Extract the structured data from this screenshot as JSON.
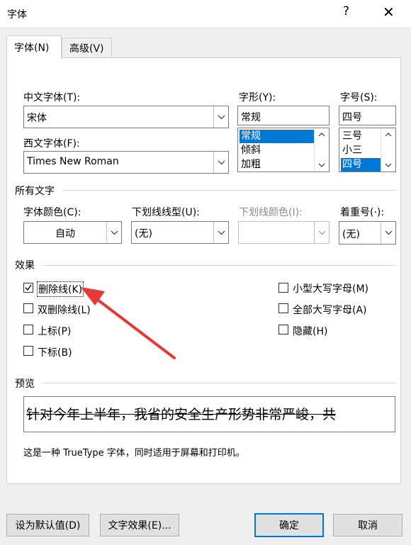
{
  "window": {
    "title": "字体",
    "help": "?",
    "close": "✕"
  },
  "tabs": [
    {
      "label": "字体(N)"
    },
    {
      "label": "高级(V)"
    }
  ],
  "font": {
    "chinese_label": "中文字体(T):",
    "chinese_value": "宋体",
    "western_label": "西文字体(F):",
    "western_value": "Times New Roman",
    "style_label": "字形(Y):",
    "style_value": "常规",
    "style_options": [
      "常规",
      "倾斜",
      "加粗"
    ],
    "size_label": "字号(S):",
    "size_value": "四号",
    "size_options": [
      "三号",
      "小三",
      "四号"
    ]
  },
  "all_text": {
    "section": "所有文字",
    "color_label": "字体颜色(C):",
    "color_value": "自动",
    "underline_label": "下划线线型(U):",
    "underline_value": "(无)",
    "underline_color_label": "下划线颜色(I):",
    "emphasis_label": "着重号(·):",
    "emphasis_value": "(无)"
  },
  "effects": {
    "section": "效果",
    "strikethrough": "删除线(K)",
    "double_strikethrough": "双删除线(L)",
    "superscript": "上标(P)",
    "subscript": "下标(B)",
    "small_caps": "小型大写字母(M)",
    "all_caps": "全部大写字母(A)",
    "hidden": "隐藏(H)"
  },
  "preview": {
    "section": "预览",
    "text": "针对今年上半年，我省的安全生产形势非常严峻，共",
    "description": "这是一种 TrueType 字体，同时适用于屏幕和打印机。"
  },
  "buttons": {
    "set_default": "设为默认值(D)",
    "text_effects": "文字效果(E)...",
    "ok": "确定",
    "cancel": "取消"
  },
  "colors": {
    "selection": "#0078d7",
    "annotation_arrow": "#e53935"
  }
}
